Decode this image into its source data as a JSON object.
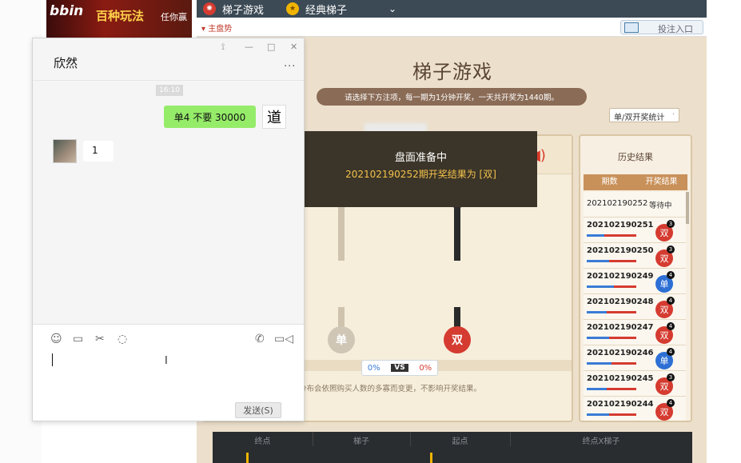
{
  "banner": {
    "logo": "bbin",
    "headline": "百种玩法",
    "tagline": "任你赢"
  },
  "topnav": {
    "items": [
      {
        "label": "梯子游戏",
        "icon": "gear-icon"
      },
      {
        "label": "经典梯子",
        "icon": "star-icon"
      }
    ],
    "dropdown_icon": "chevron-down-icon",
    "trend_link": "主盘势",
    "bet_entry": "投注入口"
  },
  "game": {
    "title": "梯子游戏",
    "instructions": "请选择下方注项，每一期为1分钟开奖，一天共开奖为1440期。",
    "stats_select": "单/双开奖统计",
    "overlay_title": "盘面准备中",
    "overlay_result": "202102190252期开奖结果为 [双]",
    "left_top_node": "✕",
    "left_bottom_node": "单",
    "right_bottom_node": "双",
    "vs": {
      "left": "0%",
      "label": "VS",
      "right": "0%"
    },
    "notice": "分布会依照购买人数的多寡而变更，不影响开奖结果。"
  },
  "history": {
    "title": "历史结果",
    "col_period": "期数",
    "col_result": "开奖结果",
    "pending_id": "202102190252",
    "pending_label": "等待中",
    "rows": [
      {
        "id": "202102190251",
        "num": "3",
        "result": "双",
        "color": "#d53b30",
        "split": 0.35
      },
      {
        "id": "202102190250",
        "num": "3",
        "result": "双",
        "color": "#d53b30",
        "split": 0.45
      },
      {
        "id": "202102190249",
        "num": "4",
        "result": "单",
        "color": "#2d6fd4",
        "split": 0.55
      },
      {
        "id": "202102190248",
        "num": "4",
        "result": "双",
        "color": "#d53b30",
        "split": 0.4
      },
      {
        "id": "202102190247",
        "num": "4",
        "result": "双",
        "color": "#d53b30",
        "split": 0.45
      },
      {
        "id": "202102190246",
        "num": "4",
        "result": "单",
        "color": "#2d6fd4",
        "split": 0.5
      },
      {
        "id": "202102190245",
        "num": "3",
        "result": "双",
        "color": "#d53b30",
        "split": 0.4
      },
      {
        "id": "202102190244",
        "num": "4",
        "result": "双",
        "color": "#d53b30",
        "split": 0.45
      }
    ]
  },
  "bottom_table": {
    "headers": [
      "终点",
      "梯子",
      "起点",
      "终点X梯子"
    ]
  },
  "chat": {
    "contact_name": "欣然",
    "more": "...",
    "timestamp": "16:10",
    "my_message": "单4   不要   30000",
    "my_avatar_char": "道",
    "their_message": "1",
    "send_button": "发送(S)",
    "ibeam": "I"
  }
}
